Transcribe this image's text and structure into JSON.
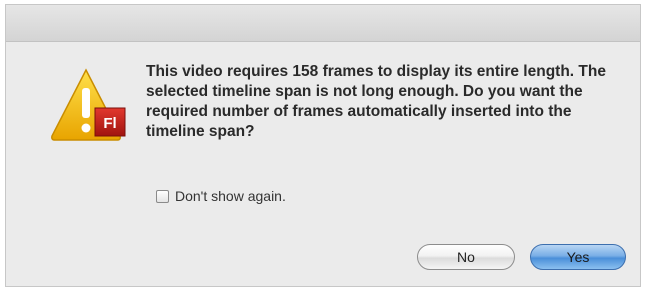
{
  "dialog": {
    "message": "This video requires 158 frames to display its entire length. The selected timeline span is not long enough. Do you want the required number of frames automatically inserted into the timeline span?",
    "icon": "warning-triangle-icon",
    "app_badge_text": "Fl",
    "checkbox": {
      "label": "Don't show again.",
      "checked": false
    },
    "buttons": {
      "no_label": "No",
      "yes_label": "Yes",
      "default": "Yes"
    }
  },
  "colors": {
    "warning_yellow": "#f5c400",
    "flash_badge": "#c8221b",
    "default_button_blue": "#4a8fd9"
  }
}
